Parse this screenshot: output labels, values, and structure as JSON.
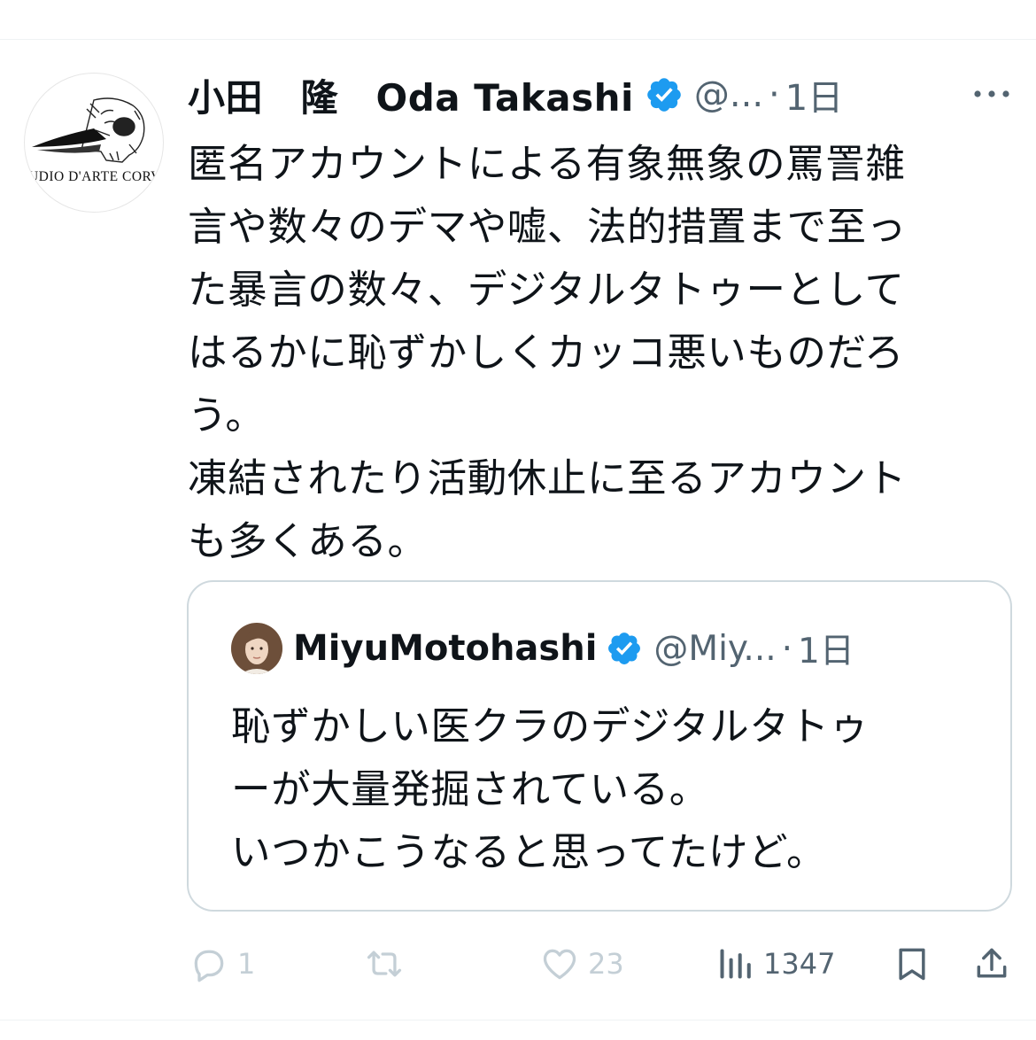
{
  "tweet": {
    "display_name": "小田　隆　Oda Takashi",
    "handle": "@...",
    "separator": "·",
    "time": "1日",
    "avatar_text": "TUDIO D'ARTE CORVO",
    "lines": [
      "匿名アカウントによる有象無象の罵詈雑",
      "言や数々のデマや嘘、法的措置まで至っ",
      "た暴言の数々、デジタルタトゥーとして",
      "はるかに恥ずかしくカッコ悪いものだろ",
      "う。",
      "凍結されたり活動休止に至るアカウント",
      "も多くある。"
    ]
  },
  "quote": {
    "display_name": "MiyuMotohashi",
    "handle": "@Miy...",
    "separator": "·",
    "time": "1日",
    "lines": [
      "恥ずかしい医クラのデジタルタトゥ",
      "ーが大量発掘されている。",
      "いつかこうなると思ってたけど。"
    ]
  },
  "actions": {
    "reply_count": "1",
    "retweet_count": "",
    "like_count": "23",
    "views_count": "1347"
  },
  "icons": [
    "verified-badge-icon",
    "more-icon",
    "reply-icon",
    "retweet-icon",
    "like-icon",
    "views-icon",
    "bookmark-icon",
    "share-icon"
  ],
  "colors": {
    "verified_blue": "#1d9bf0",
    "secondary_text": "#536471",
    "border": "#cfd9de"
  }
}
